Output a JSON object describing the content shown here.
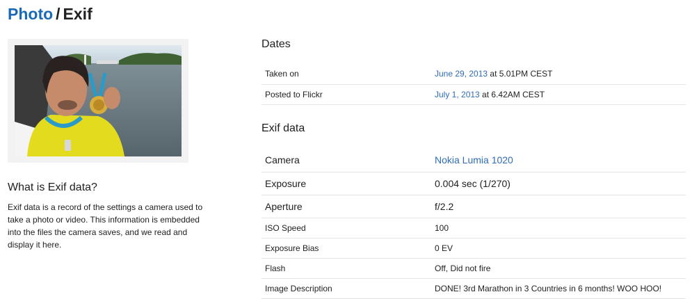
{
  "breadcrumb": {
    "parent": "Photo",
    "separator": "/",
    "current": "Exif"
  },
  "sidebar": {
    "heading": "What is Exif data?",
    "text": "Exif data is a record of the settings a camera used to take a photo or video. This information is embedded into the files the camera saves, and we read and display it here."
  },
  "dates": {
    "heading": "Dates",
    "rows": [
      {
        "label": "Taken on",
        "link": "June 29, 2013",
        "rest": " at 5.01PM CEST"
      },
      {
        "label": "Posted to Flickr",
        "link": "July 1, 2013",
        "rest": " at 6.42AM CEST"
      }
    ]
  },
  "exif": {
    "heading": "Exif data",
    "camera": {
      "label": "Camera",
      "value": "Nokia Lumia 1020"
    },
    "rows": [
      {
        "label": "Exposure",
        "value": "0.004 sec (1/270)"
      },
      {
        "label": "Aperture",
        "value": "f/2.2"
      },
      {
        "label": "ISO Speed",
        "value": "100"
      },
      {
        "label": "Exposure Bias",
        "value": "0 EV"
      },
      {
        "label": "Flash",
        "value": "Off, Did not fire"
      },
      {
        "label": "Image Description",
        "value": "DONE! 3rd Marathon in 3 Countries in 6 months! WOO HOO!"
      }
    ]
  },
  "colors": {
    "link": "#2f6cb5",
    "title_link": "#1b6ab8",
    "text": "#212124",
    "divider": "#e4e4e4",
    "frame": "#f2f2f2"
  }
}
